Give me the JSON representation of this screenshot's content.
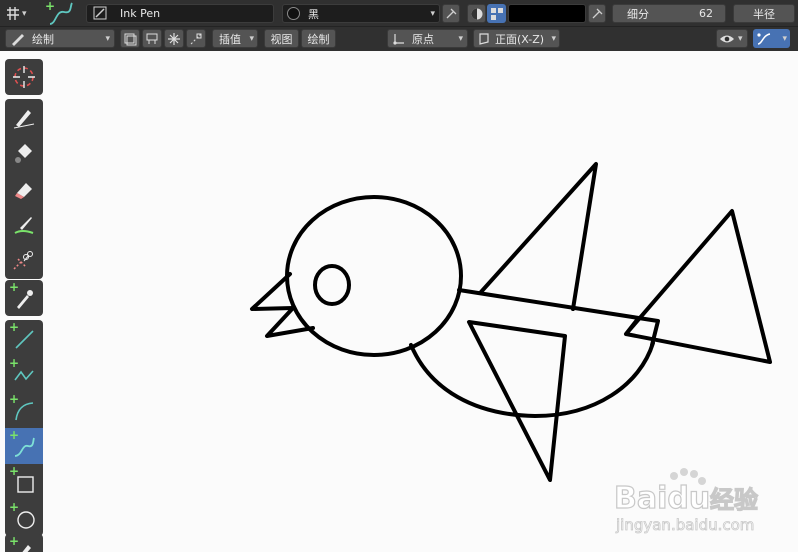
{
  "header": {
    "brush_name": "Ink Pen",
    "material_name": "黑",
    "subdivide_label": "细分",
    "subdivide_value": "62",
    "radius_label": "半径"
  },
  "secondbar": {
    "mode_label": "绘制",
    "interp_label": "插值",
    "view_label": "视图",
    "draw_label": "绘制",
    "origin_label": "原点",
    "front_label": "正面(X-Z)"
  },
  "colors": {
    "ui_bg": "#303030",
    "active_tool": "#4772b3",
    "stroke": "#000000",
    "canvas": "#fbfbfb"
  },
  "tools": [
    {
      "name": "cursor-tool",
      "icon": "cursor-icon"
    },
    {
      "name": "draw-tool",
      "icon": "pencil-icon"
    },
    {
      "name": "fill-tool",
      "icon": "bucket-icon"
    },
    {
      "name": "erase-tool",
      "icon": "eraser-icon"
    },
    {
      "name": "tint-tool",
      "icon": "brush-icon"
    },
    {
      "name": "cutter-tool",
      "icon": "scissors-icon"
    },
    {
      "name": "eyedropper-tool",
      "icon": "eyedropper-icon"
    },
    {
      "name": "line-tool",
      "icon": "line-icon"
    },
    {
      "name": "polyline-tool",
      "icon": "polyline-icon"
    },
    {
      "name": "arc-tool",
      "icon": "arc-icon"
    },
    {
      "name": "curve-tool",
      "icon": "curve-icon",
      "active": true
    },
    {
      "name": "box-tool",
      "icon": "box-icon"
    },
    {
      "name": "circle-tool",
      "icon": "circle-icon"
    },
    {
      "name": "annotate-tool",
      "icon": "annotate-icon"
    }
  ],
  "watermark": {
    "brand": "Baidu",
    "brand_cn": "经验",
    "url": "jingyan.baidu.com"
  }
}
